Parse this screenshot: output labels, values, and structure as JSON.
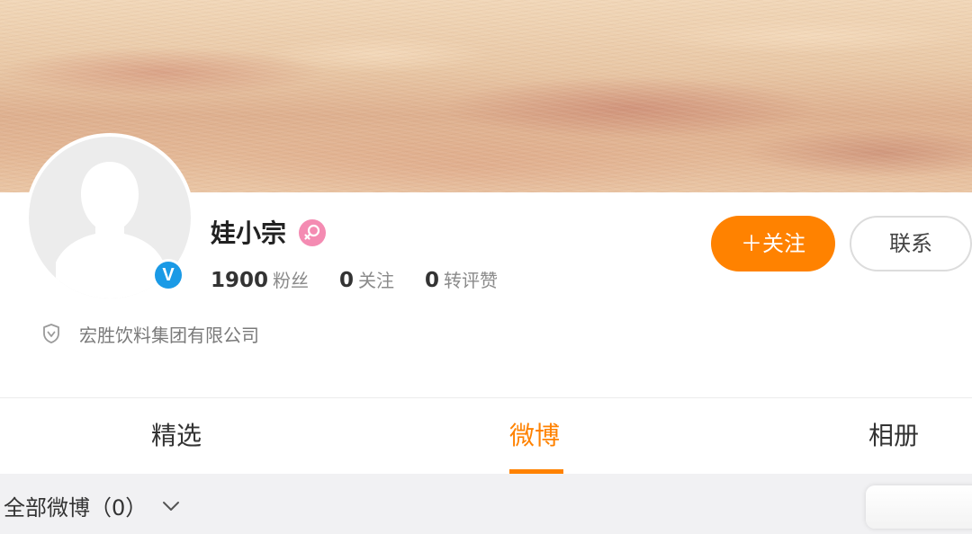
{
  "profile": {
    "name": "娃小宗",
    "gender_icon": "female-icon",
    "verified_icon": "verified-v-icon",
    "verified_label": "V",
    "avatar_icon": "default-avatar-icon",
    "company_icon": "shield-icon",
    "company": "宏胜饮料集团有限公司"
  },
  "stats": [
    {
      "value": "1900",
      "label": "粉丝"
    },
    {
      "value": "0",
      "label": "关注"
    },
    {
      "value": "0",
      "label": "转评赞"
    }
  ],
  "actions": {
    "follow_label": "＋关注",
    "contact_label": "联系"
  },
  "tabs": [
    {
      "label": "精选",
      "active": false
    },
    {
      "label": "微博",
      "active": true
    },
    {
      "label": "相册",
      "active": false
    }
  ],
  "filter": {
    "label": "全部微博（0）",
    "dropdown_icon": "chevron-down-icon"
  },
  "colors": {
    "accent": "#ff8200",
    "verified": "#1a9ae6",
    "gender_female": "#f48bb2"
  }
}
